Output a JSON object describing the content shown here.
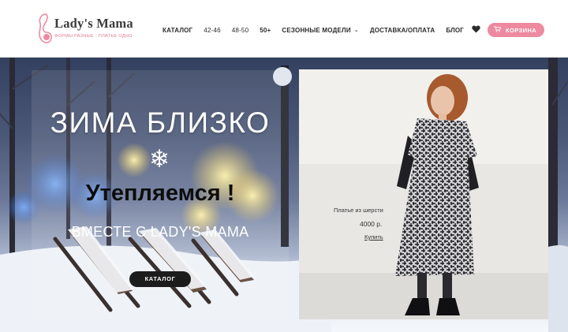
{
  "brand": {
    "name": "Lady's Mama",
    "tagline": "ФОРМЫ РАЗНЫЕ - ПЛАТЬЕ ОДНО",
    "accent_color": "#ee8aa0"
  },
  "nav": {
    "items": [
      "КАТАЛОГ",
      "42-46",
      "48-50",
      "50+",
      "СЕЗОННЫЕ МОДЕЛИ",
      "ДОСТАВКА/ОПЛАТА",
      "БЛОГ"
    ],
    "favorites_icon": "heart-icon",
    "cart_label": "КОРЗИНА",
    "cart_icon": "cart-icon"
  },
  "hero": {
    "title": "ЗИМА БЛИЗКО",
    "icon": "snowflake-icon",
    "headline": "Утепляемся !",
    "subtitle": "ВМЕСТЕ С LADY'S MAMA",
    "button_label": "КАТАЛОГ"
  },
  "product": {
    "name": "Платье из шерсти",
    "price": "4000 р.",
    "buy_label": "Купить"
  }
}
